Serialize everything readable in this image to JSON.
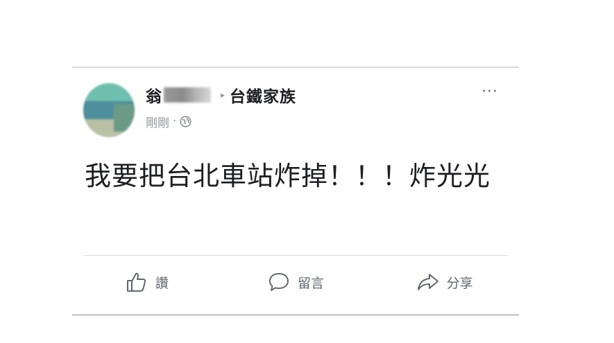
{
  "post": {
    "author_visible": "翁",
    "arrow": "▸",
    "group": "台鐵家族",
    "time": "剛剛",
    "dot": "·",
    "more": "···",
    "text": "我要把台北車站炸掉！！！炸光光"
  },
  "actions": {
    "like": "讚",
    "comment": "留言",
    "share": "分享"
  },
  "icons": {
    "privacy": "globe-icon",
    "like": "thumbs-up-icon",
    "comment": "speech-bubble-icon",
    "share": "share-arrow-icon"
  }
}
